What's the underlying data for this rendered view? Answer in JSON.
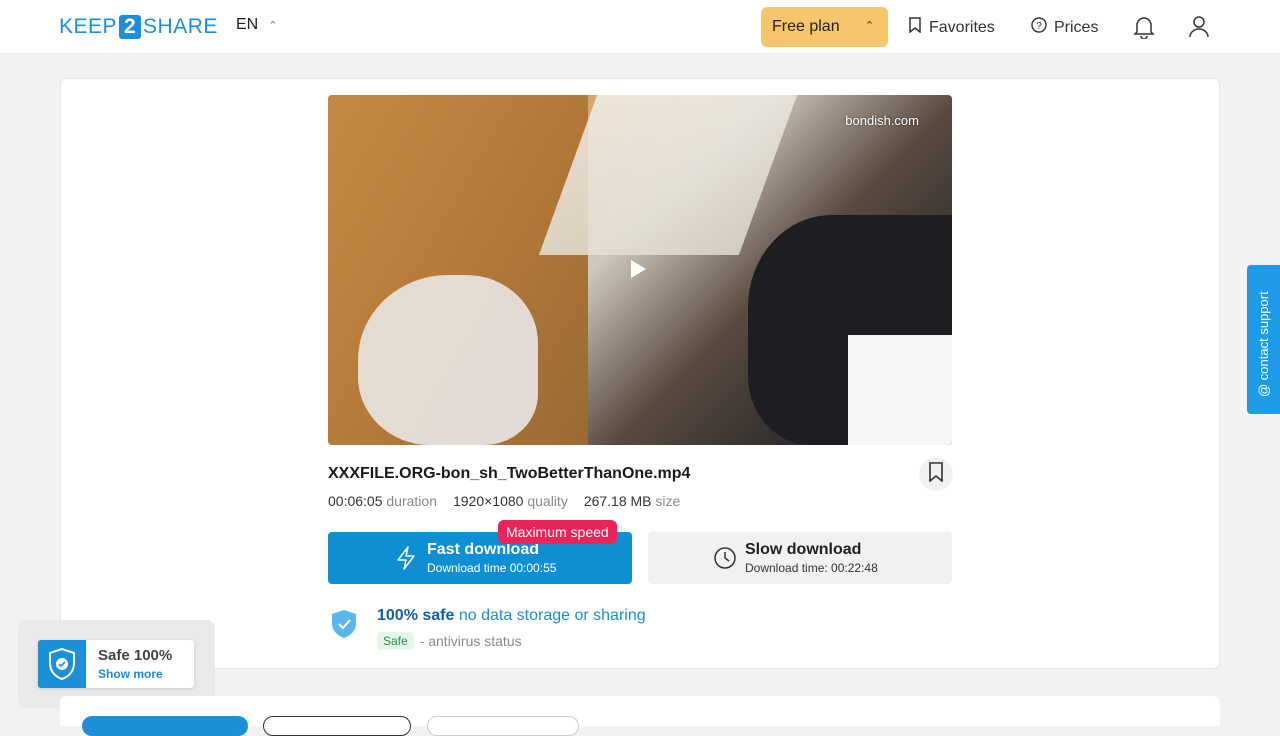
{
  "header": {
    "logo_left": "KEEP",
    "logo_mid": "2",
    "logo_right": "SHARE",
    "language": "EN",
    "plan_label": "Free plan",
    "favorites_label": "Favorites",
    "prices_label": "Prices",
    "icons": [
      "chevron-up-icon",
      "bookmark-icon",
      "help-circle-icon",
      "bell-icon",
      "user-icon"
    ]
  },
  "video": {
    "watermark": "bondish.com"
  },
  "file": {
    "name": "XXXFILE.ORG-bon_sh_TwoBetterThanOne.mp4",
    "duration_value": "00:06:05",
    "duration_unit": "duration",
    "quality_value": "1920×1080",
    "quality_unit": "quality",
    "size_value": "267.18 MB",
    "size_unit": "size"
  },
  "download": {
    "fast_label": "Fast download",
    "fast_time": "Download time 00:00:55",
    "speed_badge": "Maximum speed",
    "slow_label": "Slow download",
    "slow_time": "Download time: 00:22:48"
  },
  "safety": {
    "headline_strong": "100% safe",
    "headline_light": "no data storage or sharing",
    "tag": "Safe",
    "status_text": "- antivirus status"
  },
  "widget": {
    "title": "Safe 100%",
    "link": "Show more"
  },
  "support": {
    "label": "@ contact support"
  },
  "colors": {
    "brand_blue": "#1d8fd8",
    "plan_yellow": "#f7c56a",
    "badge_red": "#e8245b",
    "fast_blue": "#0e8fd4"
  }
}
